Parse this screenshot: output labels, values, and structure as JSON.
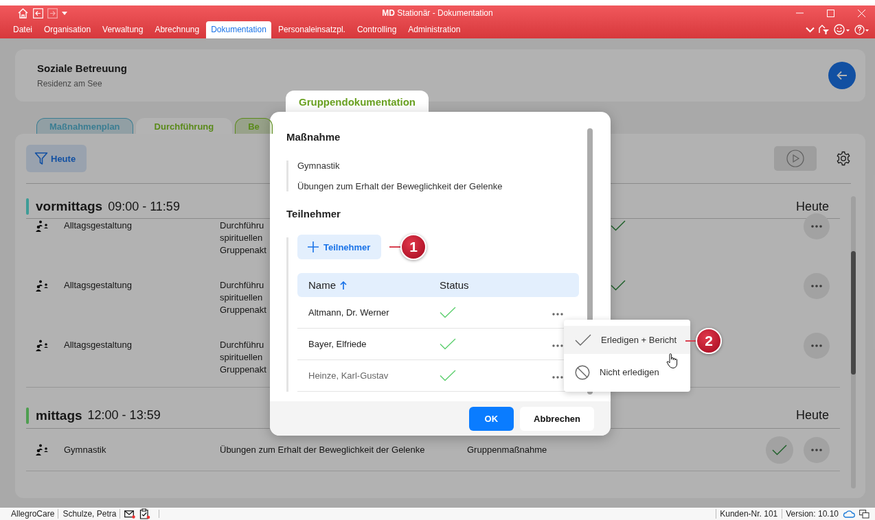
{
  "window": {
    "title": "**MD** Stationär - Dokumentation"
  },
  "menu": [
    {
      "label": "Datei",
      "selected": false
    },
    {
      "label": "Organisation",
      "selected": false
    },
    {
      "label": "Verwaltung",
      "selected": false
    },
    {
      "label": "Abrechnung",
      "selected": false
    },
    {
      "label": "Dokumentation",
      "selected": true
    },
    {
      "label": "Personaleinsatzpl.",
      "selected": false
    },
    {
      "label": "Controlling",
      "selected": false
    },
    {
      "label": "Administration",
      "selected": false
    }
  ],
  "header": {
    "title": "Soziale Betreuung",
    "subtitle": "Residenz am See"
  },
  "tabs": [
    {
      "label": "Maßnahmenplan",
      "selected": false,
      "color": "#3b7d92"
    },
    {
      "label": "Durchführung",
      "selected": true,
      "color": "#5a8a1a"
    },
    {
      "label": "Be",
      "selected": false,
      "color": "#5a8a1a"
    }
  ],
  "filter": {
    "label": "Heute"
  },
  "groups": [
    {
      "name": "vormittags",
      "time": "09:00 - 11:59",
      "day": "Heute",
      "color": "#3e9c97",
      "rows": [
        {
          "activity": "Alltagsgestaltung",
          "description": [
            "Durchführu",
            "spirituellen",
            "Gruppenakt"
          ],
          "done": true,
          "hovered": false
        },
        {
          "activity": "Alltagsgestaltung",
          "description": [
            "Durchführu",
            "spirituellen",
            "Gruppenakt"
          ],
          "done": true,
          "hovered": false
        },
        {
          "activity": "Alltagsgestaltung",
          "description": [
            "Durchführu",
            "spirituellen",
            "Gruppenakt"
          ]
        }
      ]
    },
    {
      "name": "mittags",
      "time": "12:00 - 13:59",
      "day": "Heute",
      "color": "#4e9e50",
      "rows": [
        {
          "activity": "Gymnastik",
          "description": [
            "Übungen zum Erhalt der Beweglichkeit der Gelenke"
          ],
          "type": "Gruppenmaßnahme",
          "done": true,
          "hovered": true
        }
      ]
    }
  ],
  "dialog": {
    "tab": "Gruppendokumentation",
    "section_1": "Maßnahme",
    "measure": [
      "Gymnastik",
      "Übungen zum Erhalt der Beweglichkeit der Gelenke"
    ],
    "section_2": "Teilnehmer",
    "add_button": "Teilnehmer",
    "columns": [
      {
        "label": "Name",
        "sorted": true
      },
      {
        "label": "Status",
        "sorted": false
      }
    ],
    "participants": [
      {
        "name": "Altmann, Dr. Werner",
        "done": true,
        "faded": false
      },
      {
        "name": "Bayer, Elfriede",
        "done": true,
        "faded": false
      },
      {
        "name": "Heinze, Karl-Gustav",
        "done": true,
        "faded": true
      }
    ],
    "buttons": [
      "OK",
      "Abbrechen"
    ]
  },
  "context_menu": [
    {
      "label": "Erledigen + Bericht",
      "kind": "check",
      "selected": true
    },
    {
      "label": "Nicht erledigen",
      "kind": "block",
      "selected": false
    }
  ],
  "callouts": [
    "1",
    "2"
  ],
  "status_bar": {
    "left": [
      "AllegroCare",
      "Schulze, Petra"
    ],
    "right": [
      "Kunden-Nr. 101",
      "Version: 10.10"
    ]
  }
}
